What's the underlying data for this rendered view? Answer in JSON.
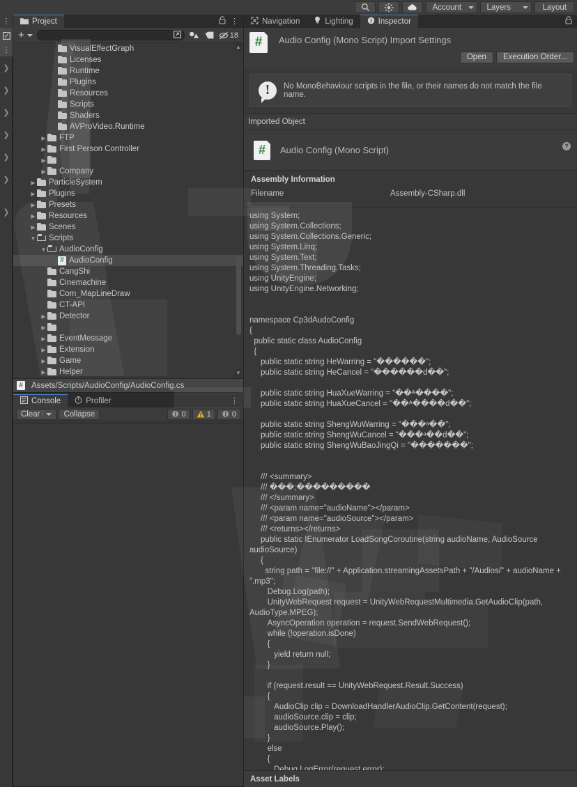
{
  "toolbar": {
    "buttons": [
      {
        "name": "search-icon",
        "label": ""
      },
      {
        "name": "gizmo-icon",
        "label": ""
      },
      {
        "name": "cloud-icon",
        "label": ""
      }
    ],
    "account_label": "Account",
    "layers_label": "Layers",
    "layout_label": "Layout"
  },
  "project": {
    "tab_label": "Project",
    "lock_icon": "lock-icon",
    "menu_icon": "kebab-menu-icon",
    "add_label": "+",
    "search_placeholder": "",
    "favorite_count": "18",
    "breadcrumb": "Assets/Scripts/AudioConfig/AudioConfig.cs",
    "tree": [
      {
        "label": "VisualEffectGraph",
        "depth": 3,
        "type": "folder",
        "arrow": "",
        "obscured": true
      },
      {
        "label": "Licenses",
        "depth": 3,
        "type": "folder",
        "arrow": "",
        "obscured": true
      },
      {
        "label": "Runtime",
        "depth": 3,
        "type": "folder",
        "arrow": "",
        "obscured": true
      },
      {
        "label": "Plugins",
        "depth": 3,
        "type": "folder",
        "arrow": "",
        "obscured": true
      },
      {
        "label": "Resources",
        "depth": 3,
        "type": "folder",
        "arrow": "",
        "obscured": true
      },
      {
        "label": "Scripts",
        "depth": 3,
        "type": "folder",
        "arrow": "",
        "obscured": true
      },
      {
        "label": "Shaders",
        "depth": 3,
        "type": "folder",
        "arrow": "",
        "obscured": true
      },
      {
        "label": "AVProVideo.Runtime",
        "depth": 3,
        "type": "folder",
        "arrow": "",
        "obscured": true
      },
      {
        "label": "FTP",
        "depth": 2,
        "type": "folder",
        "arrow": "collapsed"
      },
      {
        "label": "First Person Controller",
        "depth": 2,
        "type": "folder",
        "arrow": "collapsed"
      },
      {
        "label": "",
        "depth": 2,
        "type": "folder",
        "arrow": "collapsed"
      },
      {
        "label": "Company",
        "depth": 2,
        "type": "folder",
        "arrow": "collapsed"
      },
      {
        "label": "ParticleSystem",
        "depth": 1,
        "type": "folder",
        "arrow": "collapsed"
      },
      {
        "label": "Plugins",
        "depth": 1,
        "type": "folder",
        "arrow": "collapsed"
      },
      {
        "label": "Presets",
        "depth": 1,
        "type": "folder",
        "arrow": "collapsed"
      },
      {
        "label": "Resources",
        "depth": 1,
        "type": "folder",
        "arrow": "collapsed"
      },
      {
        "label": "Scenes",
        "depth": 1,
        "type": "folder",
        "arrow": "collapsed"
      },
      {
        "label": "Scripts",
        "depth": 1,
        "type": "folder",
        "arrow": "expanded"
      },
      {
        "label": "AudioConfig",
        "depth": 2,
        "type": "folder",
        "arrow": "expanded"
      },
      {
        "label": "AudioConfig",
        "depth": 3,
        "type": "cs",
        "arrow": "",
        "selected": true
      },
      {
        "label": "CangShi",
        "depth": 2,
        "type": "folder",
        "arrow": ""
      },
      {
        "label": "Cinemachine",
        "depth": 2,
        "type": "folder",
        "arrow": ""
      },
      {
        "label": "Com_MapLineDraw",
        "depth": 2,
        "type": "folder",
        "arrow": ""
      },
      {
        "label": "CT-API",
        "depth": 2,
        "type": "folder",
        "arrow": ""
      },
      {
        "label": "Detector",
        "depth": 2,
        "type": "folder",
        "arrow": "collapsed"
      },
      {
        "label": "",
        "depth": 2,
        "type": "folder",
        "arrow": "collapsed"
      },
      {
        "label": "EventMessage",
        "depth": 2,
        "type": "folder",
        "arrow": "collapsed"
      },
      {
        "label": "Extension",
        "depth": 2,
        "type": "folder",
        "arrow": "collapsed"
      },
      {
        "label": "Game",
        "depth": 2,
        "type": "folder",
        "arrow": "collapsed"
      },
      {
        "label": "Helper",
        "depth": 2,
        "type": "folder",
        "arrow": "collapsed"
      }
    ]
  },
  "console": {
    "tabs": [
      {
        "label": "Console",
        "active": true,
        "icon": "console-icon"
      },
      {
        "label": "Profiler",
        "active": false,
        "icon": "profiler-icon"
      }
    ],
    "clear_label": "Clear",
    "collapse_label": "Collapse",
    "error_count": "0",
    "warning_count": "1",
    "info_count": "0",
    "menu_icon": "kebab-menu-icon"
  },
  "inspector": {
    "tabs": [
      {
        "label": "Navigation",
        "active": false,
        "icon": "navigation-icon"
      },
      {
        "label": "Lighting",
        "active": false,
        "icon": "lightbulb-icon"
      },
      {
        "label": "Inspector",
        "active": true,
        "icon": "info-icon"
      }
    ],
    "lock_icon": "lock-icon",
    "title": "Audio Config (Mono Script) Import Settings",
    "open_label": "Open",
    "execution_order_label": "Execution Order...",
    "warning_text": "No MonoBehaviour scripts in the file, or their names do not match the file name.",
    "imported_object_header": "Imported Object",
    "imported_object_name": "Audio Config (Mono Script)",
    "help_icon": "help-icon",
    "assembly_header": "Assembly Information",
    "filename_key": "Filename",
    "filename_value": "Assembly-CSharp.dll",
    "asset_labels_header": "Asset Labels",
    "code": "using System;\nusing System.Collections;\nusing System.Collections.Generic;\nusing System.Linq;\nusing System.Text;\nusing System.Threading.Tasks;\nusing UnityEngine;\nusing UnityEngine.Networking;\n\n\nnamespace Cp3dAudoConfig\n{\n  public static class AudioConfig\n  {\n     public static string HeWarring = \"������\";\n     public static string HeCancel = \"������d��\";\n\n     public static string HuaXueWarring = \"��ᴬ����\";\n     public static string HuaXueCancel = \"��ᴬ����d��\";\n\n     public static string ShengWuWarring = \"���ᵃ��\";\n     public static string ShengWuCancel = \"���ᵃ��d��\";\n     public static string ShengWuBaoJingQi = \"�������\";\n\n\n     /// <summary>\n     /// ���;���������\n     /// </summary>\n     /// <param name=\"audioName\"></param>\n     /// <param name=\"audioSource\"></param>\n     /// <returns></returns>\n     public static IEnumerator LoadSongCoroutine(string audioName, AudioSource audioSource)\n     {\n       string path = \"file://\" + Application.streamingAssetsPath + \"/Audios/\" + audioName + \".mp3\";\n        Debug.Log(path);\n        UnityWebRequest request = UnityWebRequestMultimedia.GetAudioClip(path, AudioType.MPEG);\n        AsyncOperation operation = request.SendWebRequest();\n        while (!operation.isDone)\n        {\n           yield return null;\n        }\n\n        if (request.result == UnityWebRequest.Result.Success)\n        {\n           AudioClip clip = DownloadHandlerAudioClip.GetContent(request);\n           audioSource.clip = clip;\n           audioSource.Play();\n        }\n        else\n        {\n           Debug.LogError(request.error);\n        }"
  }
}
